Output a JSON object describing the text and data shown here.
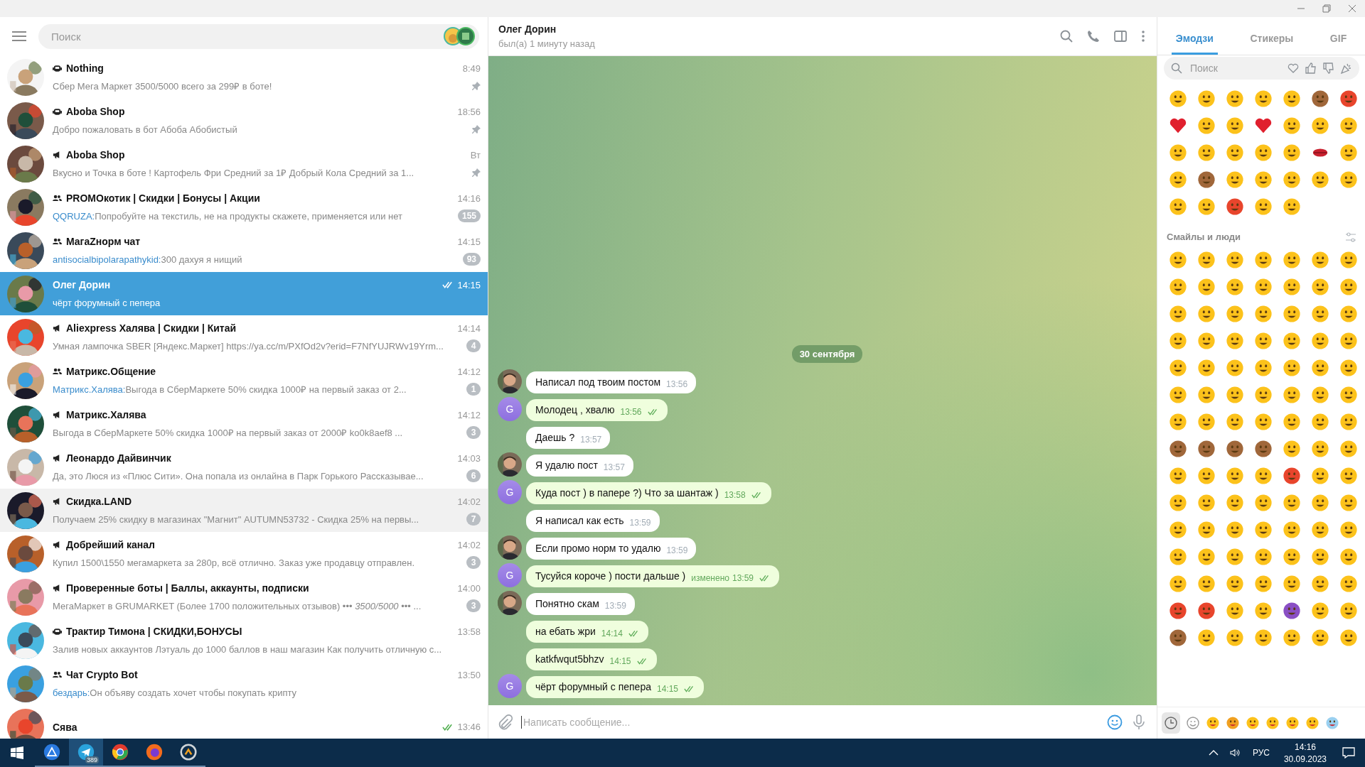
{
  "sidebar": {
    "search": {
      "placeholder": "Поиск"
    },
    "chats": [
      {
        "name": "Nothing",
        "kind": "bot",
        "time": "8:49",
        "preview": "Сбер Мега Маркет 3500/5000 всего за 299₽ в боте!",
        "pinned": true,
        "selected": false,
        "hovered": false,
        "sent": false
      },
      {
        "name": "Aboba Shop",
        "kind": "bot",
        "time": "18:56",
        "preview": "Добро пожаловать в бот Абоба Абобистый",
        "pinned": true,
        "selected": false,
        "hovered": false,
        "sent": false
      },
      {
        "name": "Aboba Shop",
        "kind": "channel",
        "time": "Вт",
        "preview": "Вкусно и Точка в боте ! Картофель Фри Средний за 1₽ Добрый Кола Средний за 1...",
        "pinned": true,
        "selected": false,
        "hovered": false,
        "sent": false
      },
      {
        "name": "PROMOкотик | Скидки | Бонусы | Акции",
        "kind": "group",
        "time": "14:16",
        "sender": "QQRUZA:",
        "preview": "Попробуйте на текстиль, не на продукты скажете, применяется или нет",
        "unread": "155",
        "pinned": false,
        "selected": false,
        "hovered": false,
        "sent": false
      },
      {
        "name": "МагаZнорм чат",
        "kind": "group",
        "time": "14:15",
        "sender": "antisocialbipolarapathykid:",
        "preview": "300 дахуя я нищий",
        "unread": "93",
        "pinned": false,
        "selected": false,
        "hovered": false,
        "sent": false
      },
      {
        "name": "Олег Дорин",
        "kind": "user",
        "time": "14:15",
        "preview": "чёрт форумный с пепера",
        "pinned": false,
        "selected": true,
        "hovered": false,
        "sent": true
      },
      {
        "name": "Aliexpress Халява | Скидки | Китай",
        "kind": "channel",
        "time": "14:14",
        "preview": "Умная лампочка SBER [Яндекс.Маркет] https://ya.cc/m/PXfOd2v?erid=F7NfYUJRWv19Yrm...",
        "unread": "4",
        "pinned": false,
        "selected": false,
        "hovered": false,
        "sent": false
      },
      {
        "name": "Матрикс.Общение",
        "kind": "group",
        "time": "14:12",
        "sender": "Матрикс.Халява:",
        "preview": "Выгода в СберМаркете 50% скидка 1000₽ на первый заказ от 2...",
        "unread": "1",
        "pinned": false,
        "selected": false,
        "hovered": false,
        "sent": false
      },
      {
        "name": "Матрикс.Халява",
        "kind": "channel",
        "time": "14:12",
        "preview": "Выгода в СберМаркете 50% скидка 1000₽ на первый заказ от 2000₽ ko0k8aef8 ...",
        "unread": "3",
        "pinned": false,
        "selected": false,
        "hovered": false,
        "sent": false
      },
      {
        "name": "Леонардо Дайвинчик",
        "kind": "channel",
        "time": "14:03",
        "preview": "Да, это Люся из «Плюс Сити». Она попала из онлайна в Парк Горького Рассказывае...",
        "unread": "6",
        "pinned": false,
        "selected": false,
        "hovered": false,
        "sent": false
      },
      {
        "name": "Скидка.LAND",
        "kind": "channel",
        "time": "14:02",
        "preview": "Получаем 25% скидку в магазинах \"Магнит\" AUTUMN53732 - Скидка 25% на первы...",
        "unread": "7",
        "pinned": false,
        "selected": false,
        "hovered": true,
        "sent": false
      },
      {
        "name": "Добрейший канал",
        "kind": "channel",
        "time": "14:02",
        "preview": "Купил 1500\\1550 мегамаркета за 280р, всё отлично. Заказ уже продавцу отправлен.",
        "unread": "3",
        "pinned": false,
        "selected": false,
        "hovered": false,
        "sent": false
      },
      {
        "name": "Проверенные боты | Баллы, аккаунты, подписки",
        "kind": "channel",
        "time": "14:00",
        "preview": "МегаМаркет в GRUMARKET (Более 1700 положительных отзывов) ••• *3500/5000* ••• ...",
        "unread": "3",
        "pinned": false,
        "selected": false,
        "hovered": false,
        "sent": false
      },
      {
        "name": "Трактир Тимона | СКИДКИ,БОНУСЫ",
        "kind": "bot",
        "time": "13:58",
        "preview": "Залив новых аккаунтов Лэтуаль до 1000 баллов в наш магазин Как получить отличную с...",
        "pinned": false,
        "selected": false,
        "hovered": false,
        "sent": false
      },
      {
        "name": "Чат Crypto Bot",
        "kind": "group",
        "time": "13:50",
        "sender": "бездарь:",
        "preview": "Он объяву создать хочет чтобы покупать крипту",
        "pinned": false,
        "selected": false,
        "hovered": false,
        "sent": false
      },
      {
        "name": "Сява",
        "kind": "user",
        "time": "13:46",
        "pinned": false,
        "selected": false,
        "hovered": false,
        "sent": true
      }
    ]
  },
  "chat": {
    "title": "Олег Дорин",
    "status": "был(а) 1 минуту назад",
    "date": "30 сентября",
    "messages": [
      {
        "kind": "incoming",
        "avatar": true,
        "text": "Написал под твоим постом",
        "time": "13:56"
      },
      {
        "kind": "outgoing",
        "avatar": true,
        "letter": "G",
        "text": "Молодец , хвалю",
        "time": "13:56"
      },
      {
        "kind": "incoming",
        "avatar": false,
        "text": "Даешь ?",
        "time": "13:57"
      },
      {
        "kind": "incoming",
        "avatar": true,
        "text": "Я удалю пост",
        "time": "13:57"
      },
      {
        "kind": "outgoing",
        "avatar": true,
        "letter": "G",
        "text": "Куда пост ) в папере ?) Что за шантаж )",
        "time": "13:58"
      },
      {
        "kind": "incoming",
        "avatar": false,
        "text": "Я написал как есть",
        "time": "13:59"
      },
      {
        "kind": "incoming",
        "avatar": true,
        "text": "Если промо норм то удалю",
        "time": "13:59"
      },
      {
        "kind": "outgoing",
        "avatar": true,
        "letter": "G",
        "text": "Тусуйся короче ) пости дальше )",
        "edited": "изменено",
        "time": "13:59"
      },
      {
        "kind": "incoming",
        "avatar": true,
        "text": "Понятно скам",
        "time": "13:59"
      },
      {
        "kind": "outgoing",
        "avatar": false,
        "text": "на ебать жри",
        "time": "14:14"
      },
      {
        "kind": "outgoing",
        "avatar": false,
        "text": "katkfwqut5bhzv",
        "time": "14:15"
      },
      {
        "kind": "outgoing",
        "avatar": true,
        "letter": "G",
        "text": "чёрт форумный с пепера",
        "time": "14:15"
      }
    ],
    "composer": {
      "placeholder": "Написать сообщение..."
    }
  },
  "emoji_panel": {
    "tabs": [
      {
        "label": "Эмодзи",
        "selected": true
      },
      {
        "label": "Стикеры",
        "selected": false
      },
      {
        "label": "GIF",
        "selected": false
      }
    ],
    "search": {
      "placeholder": "Поиск"
    },
    "section": "Смайлы и люди"
  },
  "taskbar": {
    "badge": "389",
    "language": "РУС",
    "time": "14:16",
    "date": "30.09.2023"
  }
}
